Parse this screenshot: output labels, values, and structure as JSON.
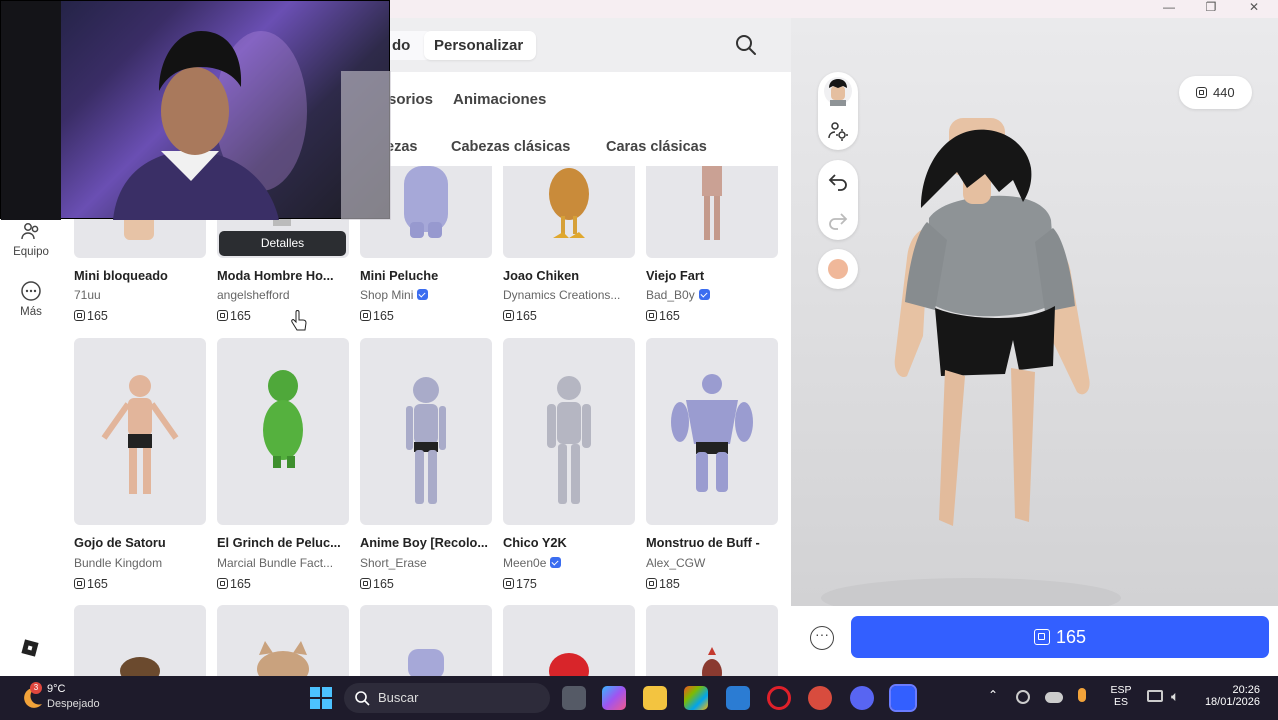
{
  "segments": {
    "inactive": "do",
    "active": "Personalizar"
  },
  "tabs": {
    "accessories": "sorios",
    "animations": "Animaciones"
  },
  "subtabs": {
    "heads": "ezas",
    "classic_heads": "Cabezas clásicas",
    "classic_faces": "Caras clásicas"
  },
  "sidebar": {
    "equipo": "Equipo",
    "mas": "Más"
  },
  "tooltip": "Detalles",
  "items": [
    {
      "title": "Mini bloqueado",
      "creator": "71uu",
      "price": "165",
      "verified": false
    },
    {
      "title": "Moda Hombre Ho...",
      "creator": "angelshefford",
      "price": "165",
      "verified": false
    },
    {
      "title": "Mini Peluche",
      "creator": "Shop Mini",
      "price": "165",
      "verified": true
    },
    {
      "title": "Joao Chiken",
      "creator": "Dynamics Creations...",
      "price": "165",
      "verified": false
    },
    {
      "title": "Viejo Fart",
      "creator": "Bad_B0y",
      "price": "165",
      "verified": true
    },
    {
      "title": "Gojo de Satoru",
      "creator": "Bundle Kingdom",
      "price": "165",
      "verified": false
    },
    {
      "title": "El Grinch de Peluc...",
      "creator": "Marcial Bundle Fact...",
      "price": "165",
      "verified": false
    },
    {
      "title": "Anime Boy [Recolo...",
      "creator": "Short_Erase",
      "price": "165",
      "verified": false
    },
    {
      "title": "Chico Y2K",
      "creator": "Meen0e",
      "price": "175",
      "verified": true
    },
    {
      "title": "Monstruo de Buff -",
      "creator": "Alex_CGW",
      "price": "185",
      "verified": false
    }
  ],
  "balance": "440",
  "buy": {
    "price": "165"
  },
  "taskbar": {
    "weather_temp": "9°C",
    "weather_desc": "Despejado",
    "weather_badge": "3",
    "search": "Buscar",
    "lang1": "ESP",
    "lang2": "ES",
    "time": "20:26",
    "date": "18/01/2026"
  },
  "colors": {
    "accent": "#335fff",
    "verified": "#3b6df0"
  }
}
